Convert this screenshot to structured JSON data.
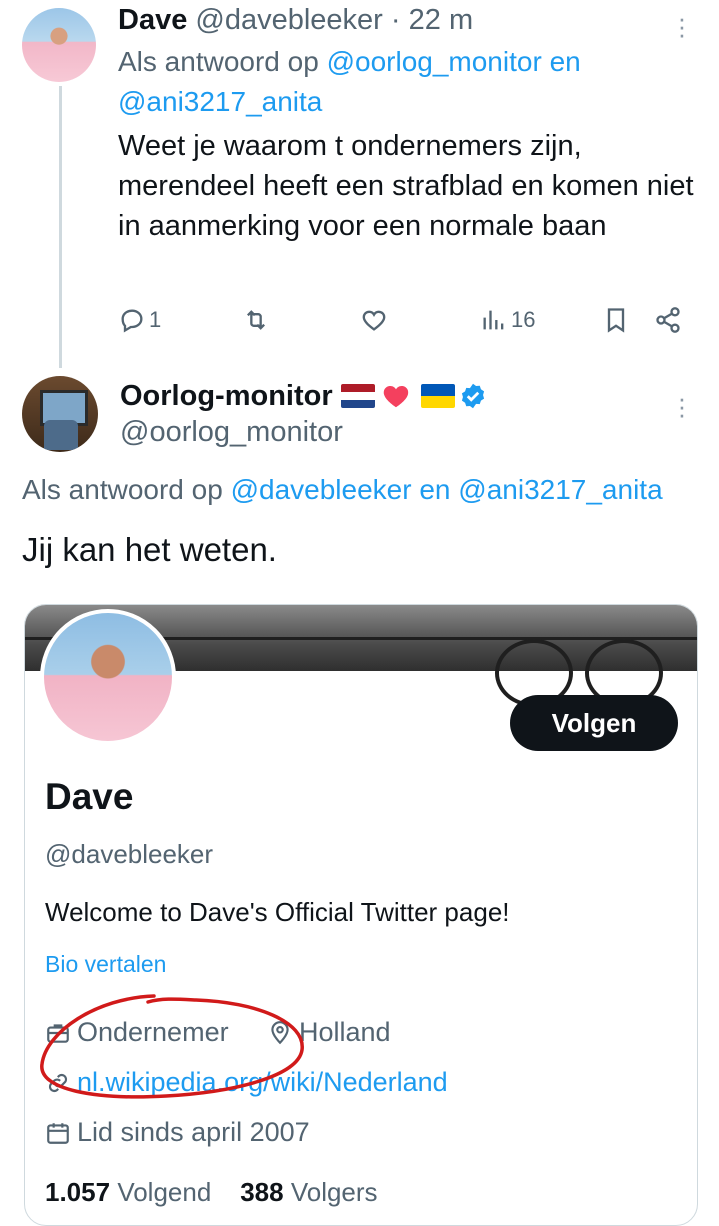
{
  "tweet1": {
    "name": "Dave",
    "handle": "@davebleeker",
    "separator": "·",
    "time": "22 m",
    "reply_prefix": "Als antwoord op",
    "reply_user1": "@oorlog_monitor",
    "reply_and": "en",
    "reply_user2": "@ani3217_anita",
    "body": "Weet je waarom t ondernemers zijn, merendeel heeft een strafblad en komen niet in aanmerking voor een normale baan",
    "replies": "1",
    "views": "16"
  },
  "tweet2": {
    "name": "Oorlog-monitor",
    "handle": "@oorlog_monitor",
    "reply_prefix": "Als antwoord op",
    "reply_user1": "@davebleeker",
    "reply_and": "en",
    "reply_user2": "@ani3217_anita",
    "body": "Jij kan het weten."
  },
  "profile_card": {
    "follow_label": "Volgen",
    "name": "Dave",
    "handle": "@davebleeker",
    "bio": "Welcome to Dave's Official Twitter page!",
    "translate_label": "Bio vertalen",
    "profession": "Ondernemer",
    "location": "Holland",
    "website": "nl.wikipedia.org/wiki/Nederland",
    "joined": "Lid sinds april 2007",
    "following_count": "1.057",
    "following_label": "Volgend",
    "followers_count": "388",
    "followers_label": "Volgers"
  },
  "colors": {
    "link": "#1d9bf0",
    "secondary": "#536471",
    "annotation_circle": "#d11a1a"
  }
}
